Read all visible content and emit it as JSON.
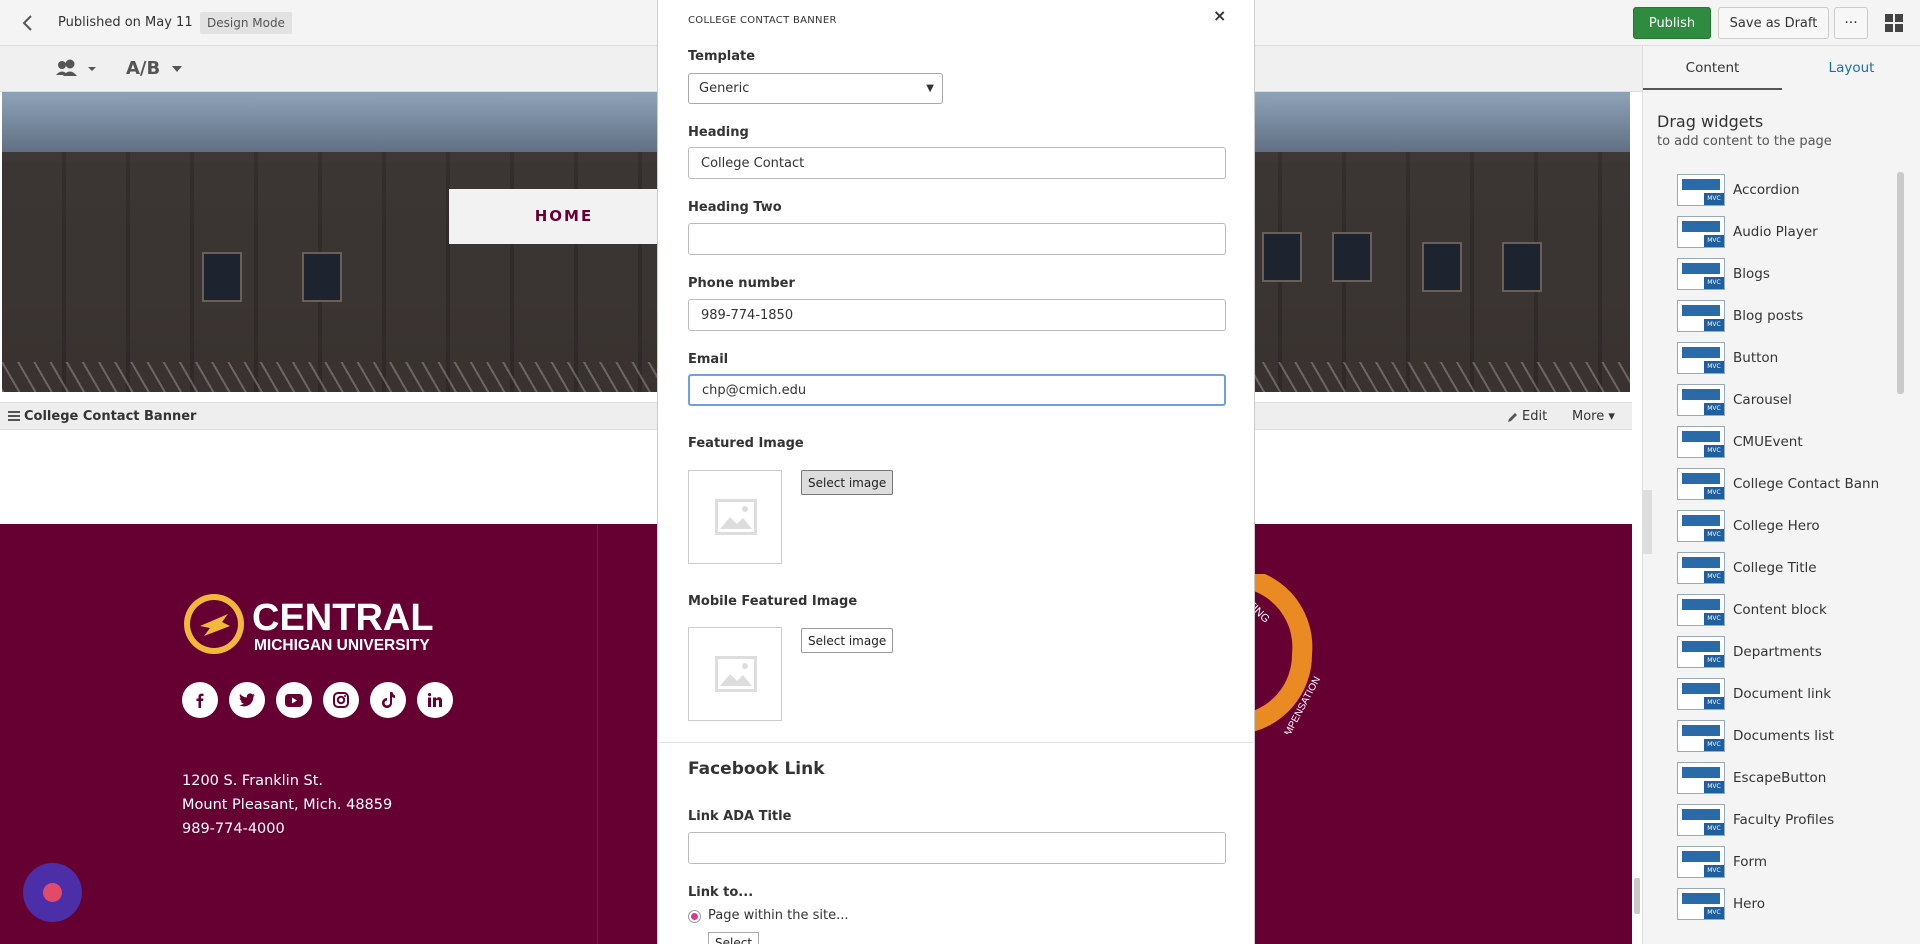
{
  "topbar": {
    "published": "Published on May 11",
    "mode": "Design Mode",
    "publish_label": "Publish",
    "draft_label": "Save as Draft",
    "more_label": "···"
  },
  "toolbar": {
    "ab_label": "A/B"
  },
  "page": {
    "home_tab": "HOME",
    "widget_name": "College Contact Banner",
    "edit_label": "Edit",
    "more_label": "More ▾"
  },
  "footer": {
    "address_line1": "1200 S. Franklin St.",
    "address_line2": "Mount Pleasant, Mich. 48859",
    "phone": "989-774-4000",
    "logo_text_main": "CENTRAL",
    "logo_text_sub": "MICHIGAN UNIVERSITY",
    "seal_text_1": "REPORTING",
    "seal_text_2": "COMPENSATION"
  },
  "modal": {
    "title": "COLLEGE CONTACT BANNER",
    "close_label": "×",
    "template_label": "Template",
    "template_value": "Generic",
    "heading_label": "Heading",
    "heading_value": "College Contact",
    "heading_two_label": "Heading Two",
    "heading_two_value": "",
    "phone_label": "Phone number",
    "phone_value": "989-774-1850",
    "email_label": "Email",
    "email_value": "chp@cmich.edu",
    "featured_image_label": "Featured Image",
    "select_image_label": "Select image",
    "mobile_image_label": "Mobile Featured Image",
    "facebook_heading": "Facebook Link",
    "link_ada_label": "Link ADA Title",
    "link_ada_value": "",
    "link_to_label": "Link to...",
    "radio_page_label": "Page within the site...",
    "select_label": "Select"
  },
  "rpanel": {
    "tab_content": "Content",
    "tab_layout": "Layout",
    "drag_heading": "Drag widgets",
    "drag_sub": "to add content to the page",
    "mvc_badge": "MVC",
    "widgets": [
      "Accordion",
      "Audio Player",
      "Blogs",
      "Blog posts",
      "Button",
      "Carousel",
      "CMUEvent",
      "College Contact Bann...",
      "College Hero",
      "College Title",
      "Content block",
      "Departments",
      "Document link",
      "Documents list",
      "EscapeButton",
      "Faculty Profiles",
      "Form",
      "Hero"
    ]
  },
  "colors": {
    "publish": "#2e8b3f",
    "footer_maroon": "#660033",
    "home_text": "#6a0032",
    "link_blue": "#1a6fb0",
    "chat_purple": "#4b2ea8"
  },
  "icons": [
    "back-icon",
    "grid-icon",
    "persona-icon",
    "pencil-icon",
    "hamburger-icon",
    "image-placeholder-icon",
    "facebook-icon",
    "twitter-icon",
    "youtube-icon",
    "instagram-icon",
    "tiktok-icon",
    "linkedin-icon",
    "chat-icon"
  ]
}
